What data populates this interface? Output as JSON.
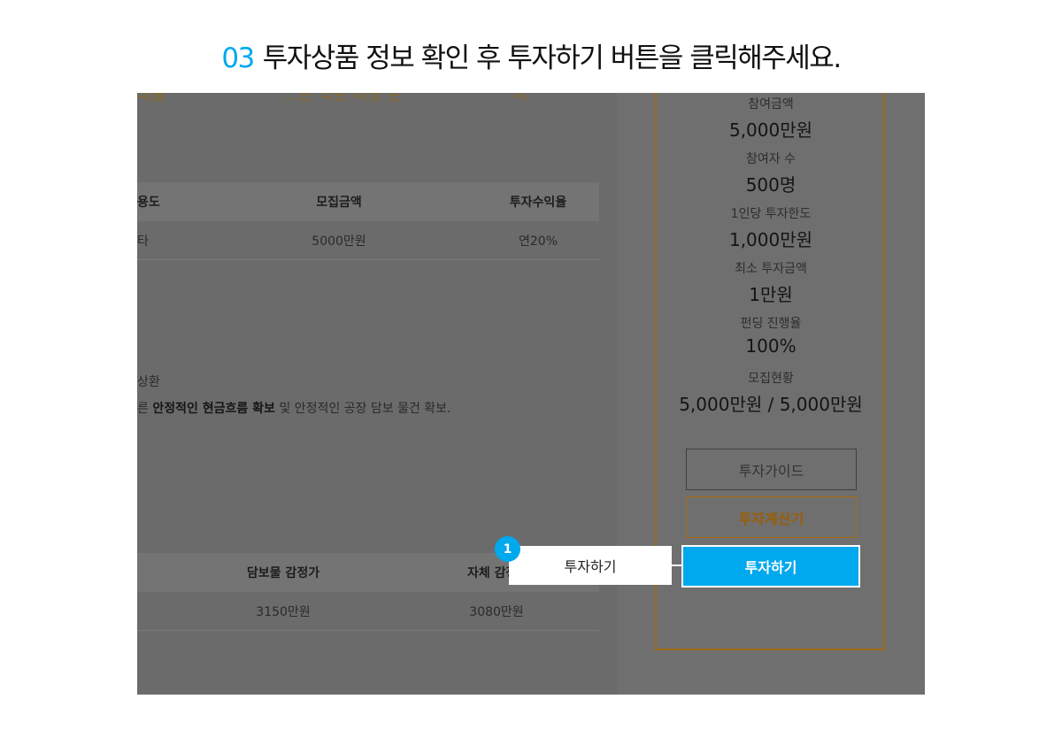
{
  "heading": {
    "step_number": "03",
    "text": "투자상품 정보 확인 후 투자하기 버튼을 클릭해주세요."
  },
  "background_page": {
    "top_fragments": [
      "대출",
      "…한 적한 어당 은",
      "지"
    ],
    "table1": {
      "headers": [
        "용도",
        "모집금액",
        "투자수익율"
      ],
      "row": [
        "타",
        "5000만원",
        "연20%"
      ]
    },
    "repay_text": "상환",
    "security_text": {
      "prefix": "른 ",
      "bold": "안정적인 현금흐름 확보",
      "rest": " 및 안정적인 공장 담보 물건 확보."
    },
    "table2": {
      "headers": [
        "담보물 감정가",
        "자체 감정"
      ],
      "row": [
        "3150만원",
        "3080만원"
      ]
    }
  },
  "summary_card": {
    "stats": [
      {
        "label": "참여금액",
        "value": "5,000만원"
      },
      {
        "label": "참여자 수",
        "value": "500명"
      },
      {
        "label": "1인당 투자한도",
        "value": "1,000만원"
      },
      {
        "label": "최소 투자금액",
        "value": "1만원"
      },
      {
        "label": "펀딩 진행율",
        "value": "100%"
      },
      {
        "label": "모집현황",
        "value": "5,000만원 / 5,000만원"
      }
    ],
    "guide_button": "투자가이드",
    "calculator_button": "투자계산기",
    "invest_button": "투자하기"
  },
  "callout": {
    "badge": "1",
    "label": "투자하기"
  },
  "colors": {
    "accent": "#00a8ee",
    "overlay": "#6b6b6b",
    "border_gold": "#9a6a14"
  }
}
